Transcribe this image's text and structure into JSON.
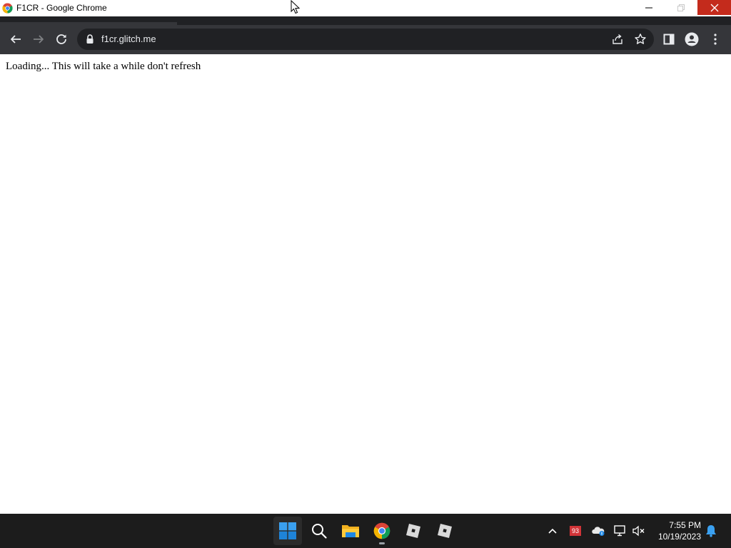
{
  "window": {
    "title": "F1CR - Google Chrome"
  },
  "toolbar": {
    "url": "f1cr.glitch.me"
  },
  "page": {
    "message": "Loading... This will take a while don't refresh"
  },
  "taskbar": {
    "tray_badge_count": "93",
    "time": "7:55 PM",
    "date": "10/19/2023"
  },
  "colors": {
    "toolbar_bg": "#35363a",
    "omnibox_bg": "#202124",
    "close_button": "#c42b1c",
    "taskbar_bg": "#1c1c1c",
    "start_blue": "#0078d4"
  }
}
